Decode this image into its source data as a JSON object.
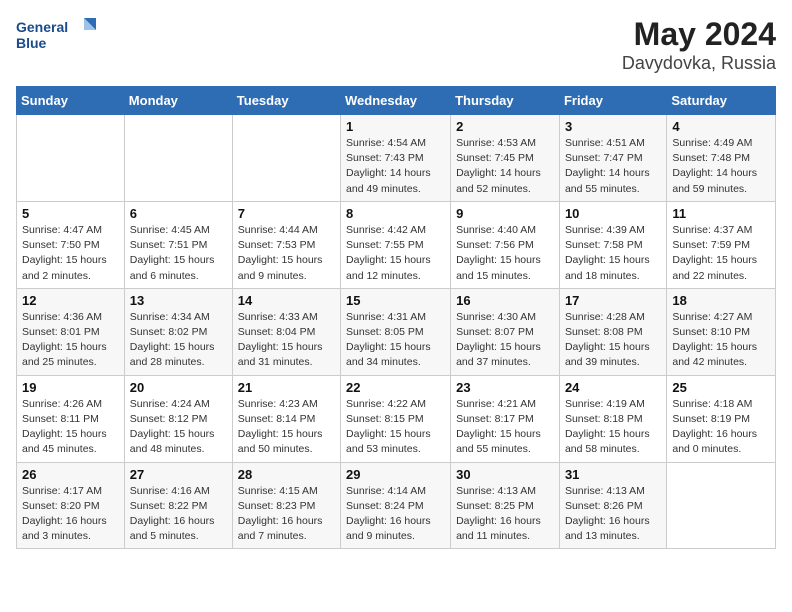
{
  "header": {
    "logo_line1": "General",
    "logo_line2": "Blue",
    "month": "May 2024",
    "location": "Davydovka, Russia"
  },
  "days_of_week": [
    "Sunday",
    "Monday",
    "Tuesday",
    "Wednesday",
    "Thursday",
    "Friday",
    "Saturday"
  ],
  "weeks": [
    [
      {
        "day": "",
        "info": ""
      },
      {
        "day": "",
        "info": ""
      },
      {
        "day": "",
        "info": ""
      },
      {
        "day": "1",
        "info": "Sunrise: 4:54 AM\nSunset: 7:43 PM\nDaylight: 14 hours\nand 49 minutes."
      },
      {
        "day": "2",
        "info": "Sunrise: 4:53 AM\nSunset: 7:45 PM\nDaylight: 14 hours\nand 52 minutes."
      },
      {
        "day": "3",
        "info": "Sunrise: 4:51 AM\nSunset: 7:47 PM\nDaylight: 14 hours\nand 55 minutes."
      },
      {
        "day": "4",
        "info": "Sunrise: 4:49 AM\nSunset: 7:48 PM\nDaylight: 14 hours\nand 59 minutes."
      }
    ],
    [
      {
        "day": "5",
        "info": "Sunrise: 4:47 AM\nSunset: 7:50 PM\nDaylight: 15 hours\nand 2 minutes."
      },
      {
        "day": "6",
        "info": "Sunrise: 4:45 AM\nSunset: 7:51 PM\nDaylight: 15 hours\nand 6 minutes."
      },
      {
        "day": "7",
        "info": "Sunrise: 4:44 AM\nSunset: 7:53 PM\nDaylight: 15 hours\nand 9 minutes."
      },
      {
        "day": "8",
        "info": "Sunrise: 4:42 AM\nSunset: 7:55 PM\nDaylight: 15 hours\nand 12 minutes."
      },
      {
        "day": "9",
        "info": "Sunrise: 4:40 AM\nSunset: 7:56 PM\nDaylight: 15 hours\nand 15 minutes."
      },
      {
        "day": "10",
        "info": "Sunrise: 4:39 AM\nSunset: 7:58 PM\nDaylight: 15 hours\nand 18 minutes."
      },
      {
        "day": "11",
        "info": "Sunrise: 4:37 AM\nSunset: 7:59 PM\nDaylight: 15 hours\nand 22 minutes."
      }
    ],
    [
      {
        "day": "12",
        "info": "Sunrise: 4:36 AM\nSunset: 8:01 PM\nDaylight: 15 hours\nand 25 minutes."
      },
      {
        "day": "13",
        "info": "Sunrise: 4:34 AM\nSunset: 8:02 PM\nDaylight: 15 hours\nand 28 minutes."
      },
      {
        "day": "14",
        "info": "Sunrise: 4:33 AM\nSunset: 8:04 PM\nDaylight: 15 hours\nand 31 minutes."
      },
      {
        "day": "15",
        "info": "Sunrise: 4:31 AM\nSunset: 8:05 PM\nDaylight: 15 hours\nand 34 minutes."
      },
      {
        "day": "16",
        "info": "Sunrise: 4:30 AM\nSunset: 8:07 PM\nDaylight: 15 hours\nand 37 minutes."
      },
      {
        "day": "17",
        "info": "Sunrise: 4:28 AM\nSunset: 8:08 PM\nDaylight: 15 hours\nand 39 minutes."
      },
      {
        "day": "18",
        "info": "Sunrise: 4:27 AM\nSunset: 8:10 PM\nDaylight: 15 hours\nand 42 minutes."
      }
    ],
    [
      {
        "day": "19",
        "info": "Sunrise: 4:26 AM\nSunset: 8:11 PM\nDaylight: 15 hours\nand 45 minutes."
      },
      {
        "day": "20",
        "info": "Sunrise: 4:24 AM\nSunset: 8:12 PM\nDaylight: 15 hours\nand 48 minutes."
      },
      {
        "day": "21",
        "info": "Sunrise: 4:23 AM\nSunset: 8:14 PM\nDaylight: 15 hours\nand 50 minutes."
      },
      {
        "day": "22",
        "info": "Sunrise: 4:22 AM\nSunset: 8:15 PM\nDaylight: 15 hours\nand 53 minutes."
      },
      {
        "day": "23",
        "info": "Sunrise: 4:21 AM\nSunset: 8:17 PM\nDaylight: 15 hours\nand 55 minutes."
      },
      {
        "day": "24",
        "info": "Sunrise: 4:19 AM\nSunset: 8:18 PM\nDaylight: 15 hours\nand 58 minutes."
      },
      {
        "day": "25",
        "info": "Sunrise: 4:18 AM\nSunset: 8:19 PM\nDaylight: 16 hours\nand 0 minutes."
      }
    ],
    [
      {
        "day": "26",
        "info": "Sunrise: 4:17 AM\nSunset: 8:20 PM\nDaylight: 16 hours\nand 3 minutes."
      },
      {
        "day": "27",
        "info": "Sunrise: 4:16 AM\nSunset: 8:22 PM\nDaylight: 16 hours\nand 5 minutes."
      },
      {
        "day": "28",
        "info": "Sunrise: 4:15 AM\nSunset: 8:23 PM\nDaylight: 16 hours\nand 7 minutes."
      },
      {
        "day": "29",
        "info": "Sunrise: 4:14 AM\nSunset: 8:24 PM\nDaylight: 16 hours\nand 9 minutes."
      },
      {
        "day": "30",
        "info": "Sunrise: 4:13 AM\nSunset: 8:25 PM\nDaylight: 16 hours\nand 11 minutes."
      },
      {
        "day": "31",
        "info": "Sunrise: 4:13 AM\nSunset: 8:26 PM\nDaylight: 16 hours\nand 13 minutes."
      },
      {
        "day": "",
        "info": ""
      }
    ]
  ]
}
